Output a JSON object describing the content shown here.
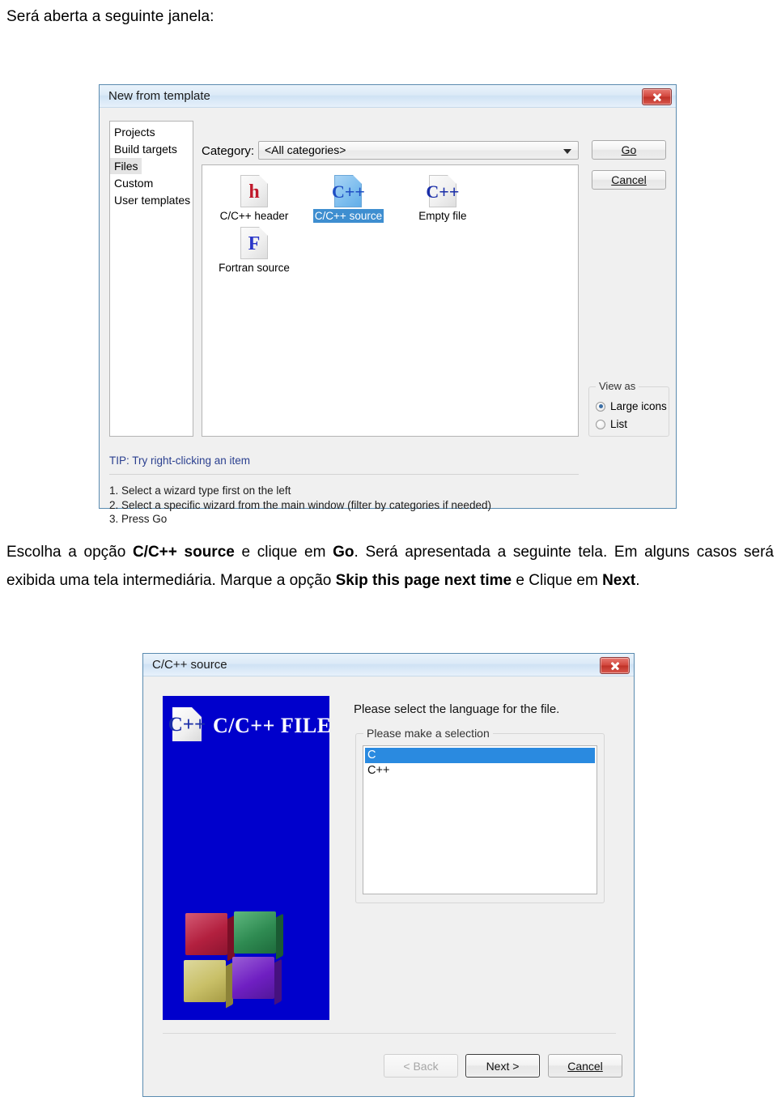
{
  "document": {
    "intro_line": "Será aberta a seguinte janela:",
    "paragraph_parts": [
      {
        "text": "Escolha a opção ",
        "bold": false
      },
      {
        "text": "C/C++ source",
        "bold": true
      },
      {
        "text": " e clique em ",
        "bold": false
      },
      {
        "text": "Go",
        "bold": true
      },
      {
        "text": ". Será apresentada a seguinte tela. Em alguns casos será exibida uma tela intermediária. Marque a opção ",
        "bold": false
      },
      {
        "text": "Skip this page next time",
        "bold": true
      },
      {
        "text": " e Clique em ",
        "bold": false
      },
      {
        "text": "Next",
        "bold": true
      },
      {
        "text": ".",
        "bold": false
      }
    ]
  },
  "dialog_new_template": {
    "title": "New from template",
    "close_label": "close",
    "wizard_types": [
      {
        "label": "Projects",
        "selected": false
      },
      {
        "label": "Build targets",
        "selected": false
      },
      {
        "label": "Files",
        "selected": true
      },
      {
        "label": "Custom",
        "selected": false
      },
      {
        "label": "User templates",
        "selected": false
      }
    ],
    "category_label": "Category:",
    "category_value": "<All categories>",
    "templates": [
      {
        "label": "C/C++ header",
        "glyph": "h",
        "glyph_color": "#c0192b",
        "selected": false
      },
      {
        "label": "C/C++ source",
        "glyph": "C++",
        "glyph_color": "#1f4fc4",
        "selected": true
      },
      {
        "label": "Empty file",
        "glyph": "C++",
        "glyph_color": "#1a2ea8",
        "selected": false
      },
      {
        "label": "Fortran source",
        "glyph": "F",
        "glyph_color": "#2a36c8",
        "selected": false
      }
    ],
    "go_button": "Go",
    "go_button_accel": "G",
    "cancel_button": "Cancel",
    "cancel_button_accel": "C",
    "view_as": {
      "group_title": "View as",
      "options": [
        {
          "label": "Large icons",
          "selected": true
        },
        {
          "label": "List",
          "selected": false
        }
      ]
    },
    "tip": "TIP: Try right-clicking an item",
    "instructions": [
      "1. Select a wizard type first on the left",
      "2. Select a specific wizard from the main window (filter by categories if needed)",
      "3. Press Go"
    ]
  },
  "dialog_ccpp_source": {
    "title": "C/C++ source",
    "close_label": "close",
    "banner_title": "C/C++ FILE",
    "banner_icon_glyph": "C++",
    "prompt": "Please select the language for the file.",
    "selection_group_title": "Please make a selection",
    "languages": [
      {
        "label": "C",
        "selected": true
      },
      {
        "label": "C++",
        "selected": false
      }
    ],
    "back_button": "< Back",
    "back_button_accel": "B",
    "back_button_disabled": true,
    "next_button": "Next >",
    "next_button_accel": "N",
    "next_button_focused": true,
    "cancel_button": "Cancel",
    "cancel_button_accel": "C"
  },
  "colors": {
    "title_bar": "#dceaf7",
    "dialog_face": "#f0f0f0",
    "dialog_border": "#5a8bb0",
    "close_red": "#c33a2e",
    "selection_blue": "#2a8ae0",
    "tip_blue": "#2a3f8f",
    "banner_blue": "#0000cc"
  }
}
